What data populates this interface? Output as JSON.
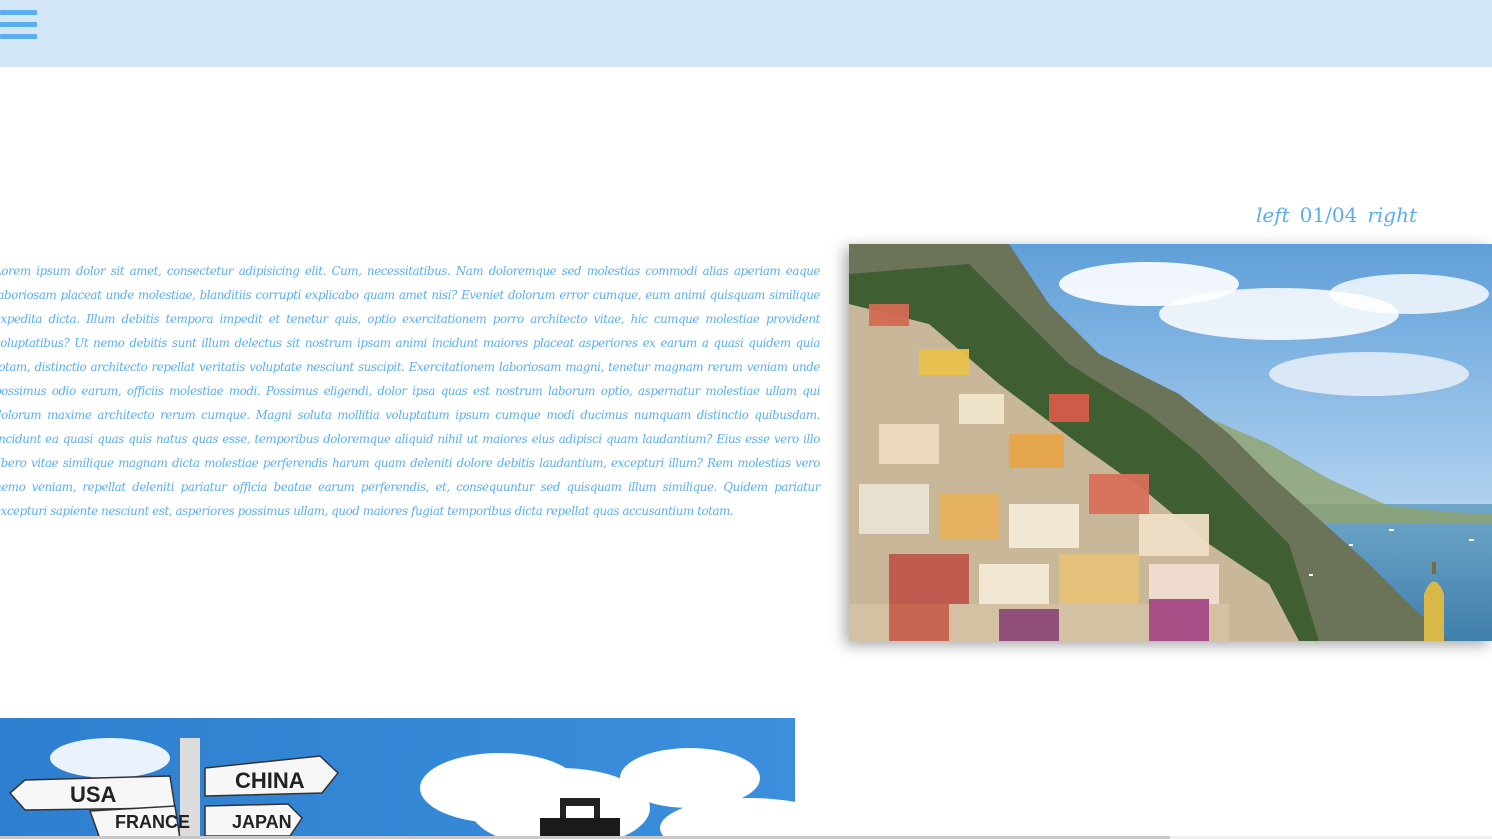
{
  "nav": {
    "menu_icon": "hamburger-menu-icon"
  },
  "slider": {
    "prev_label": "left",
    "counter": "01/04",
    "next_label": "right",
    "image_alt": "Colorful cliffside town above the sea"
  },
  "body_text": "Lorem ipsum dolor sit amet, consectetur adipisicing elit. Cum, necessitatibus. Nam doloremque sed molestias commodi alias aperiam eaque laboriosam placeat unde molestiae, blanditiis corrupti explicabo quam amet nisi? Eveniet dolorum error cumque, eum animi quisquam similique expedita dicta. Illum debitis tempora impedit et tenetur quis, optio exercitationem porro architecto vitae, hic cumque molestiae provident voluptatibus? Ut nemo debitis sunt illum delectus sit nostrum ipsam animi incidunt maiores placeat asperiores ex earum a quasi quidem quia totam, distinctio architecto repellat veritatis voluptate nesciunt suscipit. Exercitationem laboriosam magni, tenetur magnam rerum veniam unde possimus odio earum, officiis molestiae modi. Possimus eligendi, dolor ipsa quas est nostrum laborum optio, aspernatur molestiae ullam qui dolorum maxime architecto rerum cumque. Magni soluta mollitia voluptatum ipsum cumque modi ducimus numquam distinctio quibusdam. Incidunt ea quasi quas quis natus quas esse, temporibus doloremque aliquid nihil ut maiores eius adipisci quam laudantium? Eius esse vero illo libero vitae similique magnam dicta molestiae perferendis harum quam deleniti dolore debitis laudantium, excepturi illum? Rem molestias vero nemo veniam, repellat deleniti pariatur officia beatae earum perferendis, et, consequuntur sed quisquam illum similique. Quidem pariatur excepturi sapiente nesciunt est, asperiores possimus ullam, quod maiores fugiat temporibus dicta repellat quas accusantium totam.",
  "travel_sign": {
    "labels": [
      "USA",
      "CHINA",
      "FRANCE",
      "JAPAN"
    ]
  },
  "colors": {
    "accent": "#5aaef0",
    "header_bg": "#d2e6f6"
  }
}
